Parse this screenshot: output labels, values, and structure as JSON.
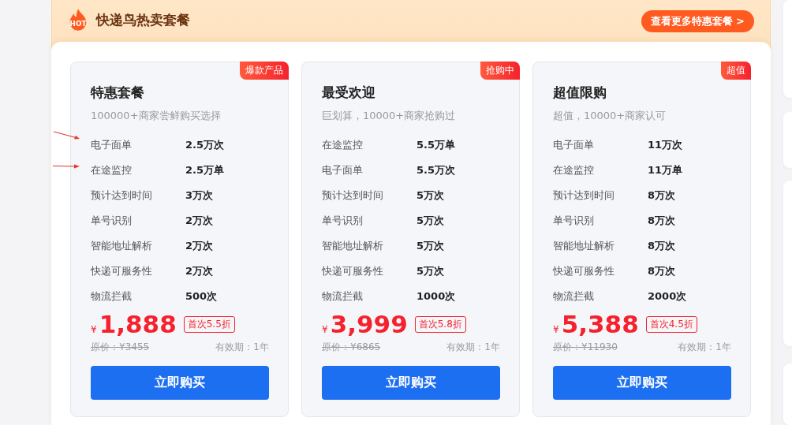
{
  "header": {
    "title": "快递鸟热卖套餐",
    "icon_text": "HOT",
    "more_button": "查看更多特惠套餐 >"
  },
  "cards": [
    {
      "badge": "爆款产品",
      "title": "特惠套餐",
      "subtitle": "100000+商家尝鲜购买选择",
      "features": [
        {
          "name": "电子面单",
          "value": "2.5万次"
        },
        {
          "name": "在途监控",
          "value": "2.5万单"
        },
        {
          "name": "预计达到时间",
          "value": "3万次"
        },
        {
          "name": "单号识别",
          "value": "2万次"
        },
        {
          "name": "智能地址解析",
          "value": "2万次"
        },
        {
          "name": "快递可服务性",
          "value": "2万次"
        },
        {
          "name": "物流拦截",
          "value": "500次"
        }
      ],
      "currency": "¥",
      "price": "1,888",
      "discount": "首次5.5折",
      "original_price": "原价：¥3455",
      "validity": "有效期：1年",
      "buy_button": "立即购买"
    },
    {
      "badge": "抢购中",
      "title": "最受欢迎",
      "subtitle": "巨划算，10000+商家抢购过",
      "features": [
        {
          "name": "在途监控",
          "value": "5.5万单"
        },
        {
          "name": "电子面单",
          "value": "5.5万次"
        },
        {
          "name": "预计达到时间",
          "value": "5万次"
        },
        {
          "name": "单号识别",
          "value": "5万次"
        },
        {
          "name": "智能地址解析",
          "value": "5万次"
        },
        {
          "name": "快递可服务性",
          "value": "5万次"
        },
        {
          "name": "物流拦截",
          "value": "1000次"
        }
      ],
      "currency": "¥",
      "price": "3,999",
      "discount": "首次5.8折",
      "original_price": "原价：¥6865",
      "validity": "有效期：1年",
      "buy_button": "立即购买"
    },
    {
      "badge": "超值",
      "title": "超值限购",
      "subtitle": "超值，10000+商家认可",
      "features": [
        {
          "name": "电子面单",
          "value": "11万次"
        },
        {
          "name": "在途监控",
          "value": "11万单"
        },
        {
          "name": "预计达到时间",
          "value": "8万次"
        },
        {
          "name": "单号识别",
          "value": "8万次"
        },
        {
          "name": "智能地址解析",
          "value": "8万次"
        },
        {
          "name": "快递可服务性",
          "value": "8万次"
        },
        {
          "name": "物流拦截",
          "value": "2000次"
        }
      ],
      "currency": "¥",
      "price": "5,388",
      "discount": "首次4.5折",
      "original_price": "原价：¥11930",
      "validity": "有效期：1年",
      "buy_button": "立即购买"
    }
  ]
}
